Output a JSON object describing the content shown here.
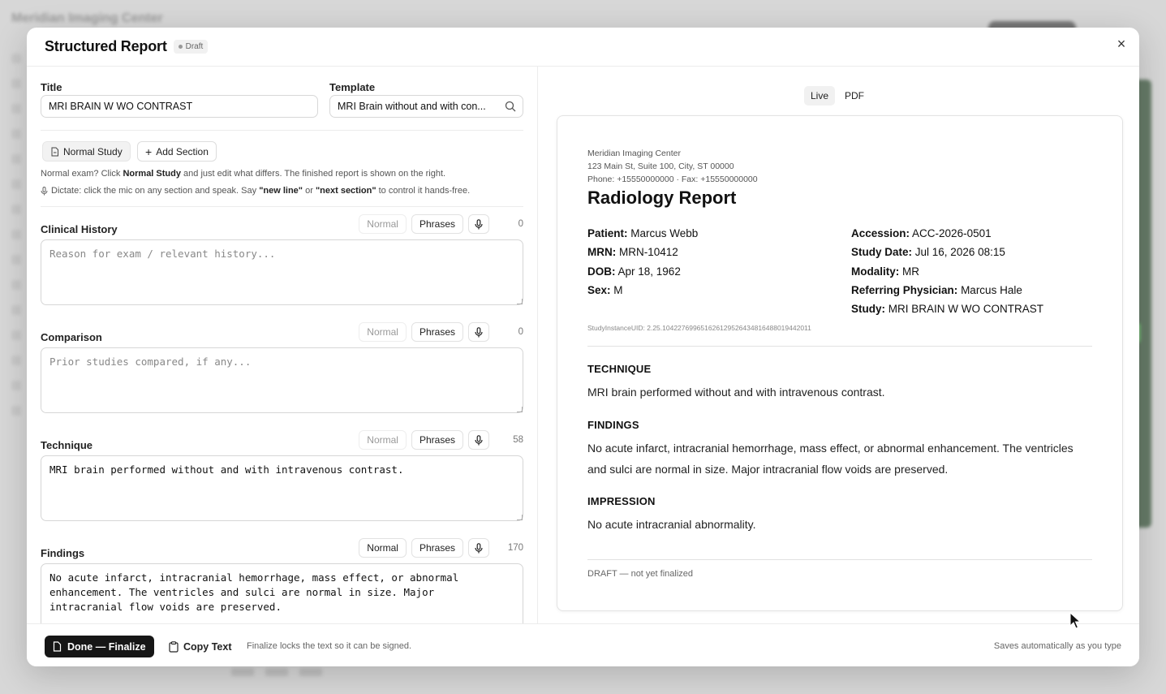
{
  "background": {
    "app_title": "Meridian Imaging Center"
  },
  "modal": {
    "title": "Structured Report",
    "status": "Draft",
    "close_icon": "close-icon"
  },
  "form": {
    "title_label": "Title",
    "title_value": "MRI BRAIN W WO CONTRAST",
    "template_label": "Template",
    "template_value": "MRI Brain without and with con...",
    "normal_study_button": "Normal Study",
    "add_section_button": "Add Section",
    "help_line1": {
      "pre": "Normal exam? Click ",
      "strong": "Normal Study",
      "post": " and just edit what differs. The finished report is shown on the right."
    },
    "help_line2": {
      "pre": "Dictate: click the mic on any section and speak. Say ",
      "strong1": "\"new line\"",
      "mid": " or ",
      "strong2": "\"next section\"",
      "post": " to control it hands-free."
    },
    "sections": [
      {
        "label": "Clinical History",
        "normal": "Normal",
        "phrases": "Phrases",
        "count": "0",
        "value": "",
        "placeholder": "Reason for exam / relevant history..."
      },
      {
        "label": "Comparison",
        "normal": "Normal",
        "phrases": "Phrases",
        "count": "0",
        "value": "",
        "placeholder": "Prior studies compared, if any..."
      },
      {
        "label": "Technique",
        "normal": "Normal",
        "phrases": "Phrases",
        "count": "58",
        "value": "MRI brain performed without and with intravenous contrast.",
        "placeholder": ""
      },
      {
        "label": "Findings",
        "normal": "Normal",
        "phrases": "Phrases",
        "count": "170",
        "value": "No acute infarct, intracranial hemorrhage, mass effect, or abnormal\nenhancement. The ventricles and sulci are normal in size. Major\nintracranial flow voids are preserved.",
        "placeholder": ""
      }
    ]
  },
  "footer": {
    "finalize_button": "Done — Finalize",
    "copy_button": "Copy Text",
    "note": "Finalize locks the text so it can be signed.",
    "autosave": "Saves automatically as you type"
  },
  "preview": {
    "tabs": [
      "Live",
      "PDF"
    ],
    "org_name": "Meridian Imaging Center",
    "org_address": "123 Main St, Suite 100, City, ST 00000",
    "org_phone": "Phone: +15550000000 · Fax: +15550000000",
    "report_title": "Radiology Report",
    "patient": {
      "label": "Patient:",
      "value": "Marcus Webb"
    },
    "mrn": {
      "label": "MRN:",
      "value": "MRN-10412"
    },
    "dob": {
      "label": "DOB:",
      "value": "Apr 18, 1962"
    },
    "sex": {
      "label": "Sex:",
      "value": "M"
    },
    "accession": {
      "label": "Accession:",
      "value": "ACC-2026-0501"
    },
    "study_date": {
      "label": "Study Date:",
      "value": "Jul 16, 2026 08:15"
    },
    "modality": {
      "label": "Modality:",
      "value": "MR"
    },
    "referring": {
      "label": "Referring Physician:",
      "value": "Marcus Hale"
    },
    "study": {
      "label": "Study:",
      "value": "MRI BRAIN W WO CONTRAST"
    },
    "uid": "StudyInstanceUID: 2.25.104227699651626129526434816488019442011",
    "technique_heading": "TECHNIQUE",
    "technique_text": "MRI brain performed without and with intravenous contrast.",
    "findings_heading": "FINDINGS",
    "findings_text": "No acute infarct, intracranial hemorrhage, mass effect, or abnormal enhancement. The ventricles and sulci are normal in size. Major intracranial flow voids are preserved.",
    "impression_heading": "IMPRESSION",
    "impression_text": "No acute intracranial abnormality.",
    "draft_note": "DRAFT — not yet finalized"
  }
}
